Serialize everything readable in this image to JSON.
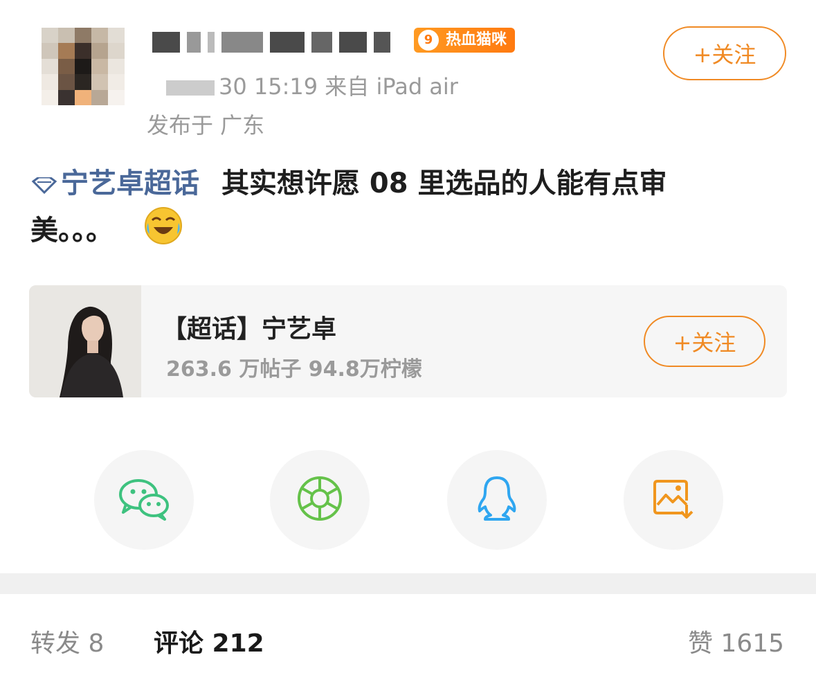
{
  "header": {
    "badge_level": "9",
    "badge_text": "热血猫咪",
    "meta_time": "30 15:19 来自 iPad air",
    "location": "发布于 广东",
    "follow_label": "+关注"
  },
  "post": {
    "topic": "宁艺卓超话",
    "text_line1": "其实想许愿 08 里选品的人能有点审",
    "text_line2": "美。。。"
  },
  "card": {
    "title": "【超话】宁艺卓",
    "stats": "263.6 万帖子 94.8万柠檬",
    "follow_label": "+关注"
  },
  "tabs": {
    "repost": "转发 8",
    "comment": "评论 212",
    "like": "赞 1615"
  },
  "colors": {
    "accent": "#f08a24",
    "topic": "#4a6899",
    "wechat": "#3ec27f",
    "moments": "#65c24a",
    "qq": "#2fa6f0",
    "save": "#f0961e"
  }
}
